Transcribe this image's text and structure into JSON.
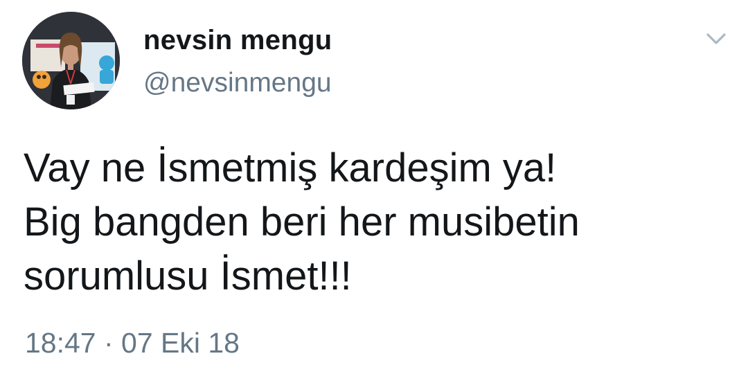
{
  "author": {
    "display_name": "nevsin mengu",
    "handle": "@nevsinmengu",
    "avatar": "profile-photo"
  },
  "menu_icon": "chevron-down-icon",
  "tweet": {
    "lines": [
      "Vay ne İsmetmiş kardeşim ya!",
      "Big bangden beri her musibetin",
      "sorumlusu İsmet!!!"
    ]
  },
  "meta": {
    "timestamp": "18:47 · 07 Eki 18"
  },
  "colors": {
    "text": "#14171a",
    "secondary": "#657786",
    "icon": "#aab8c2"
  }
}
